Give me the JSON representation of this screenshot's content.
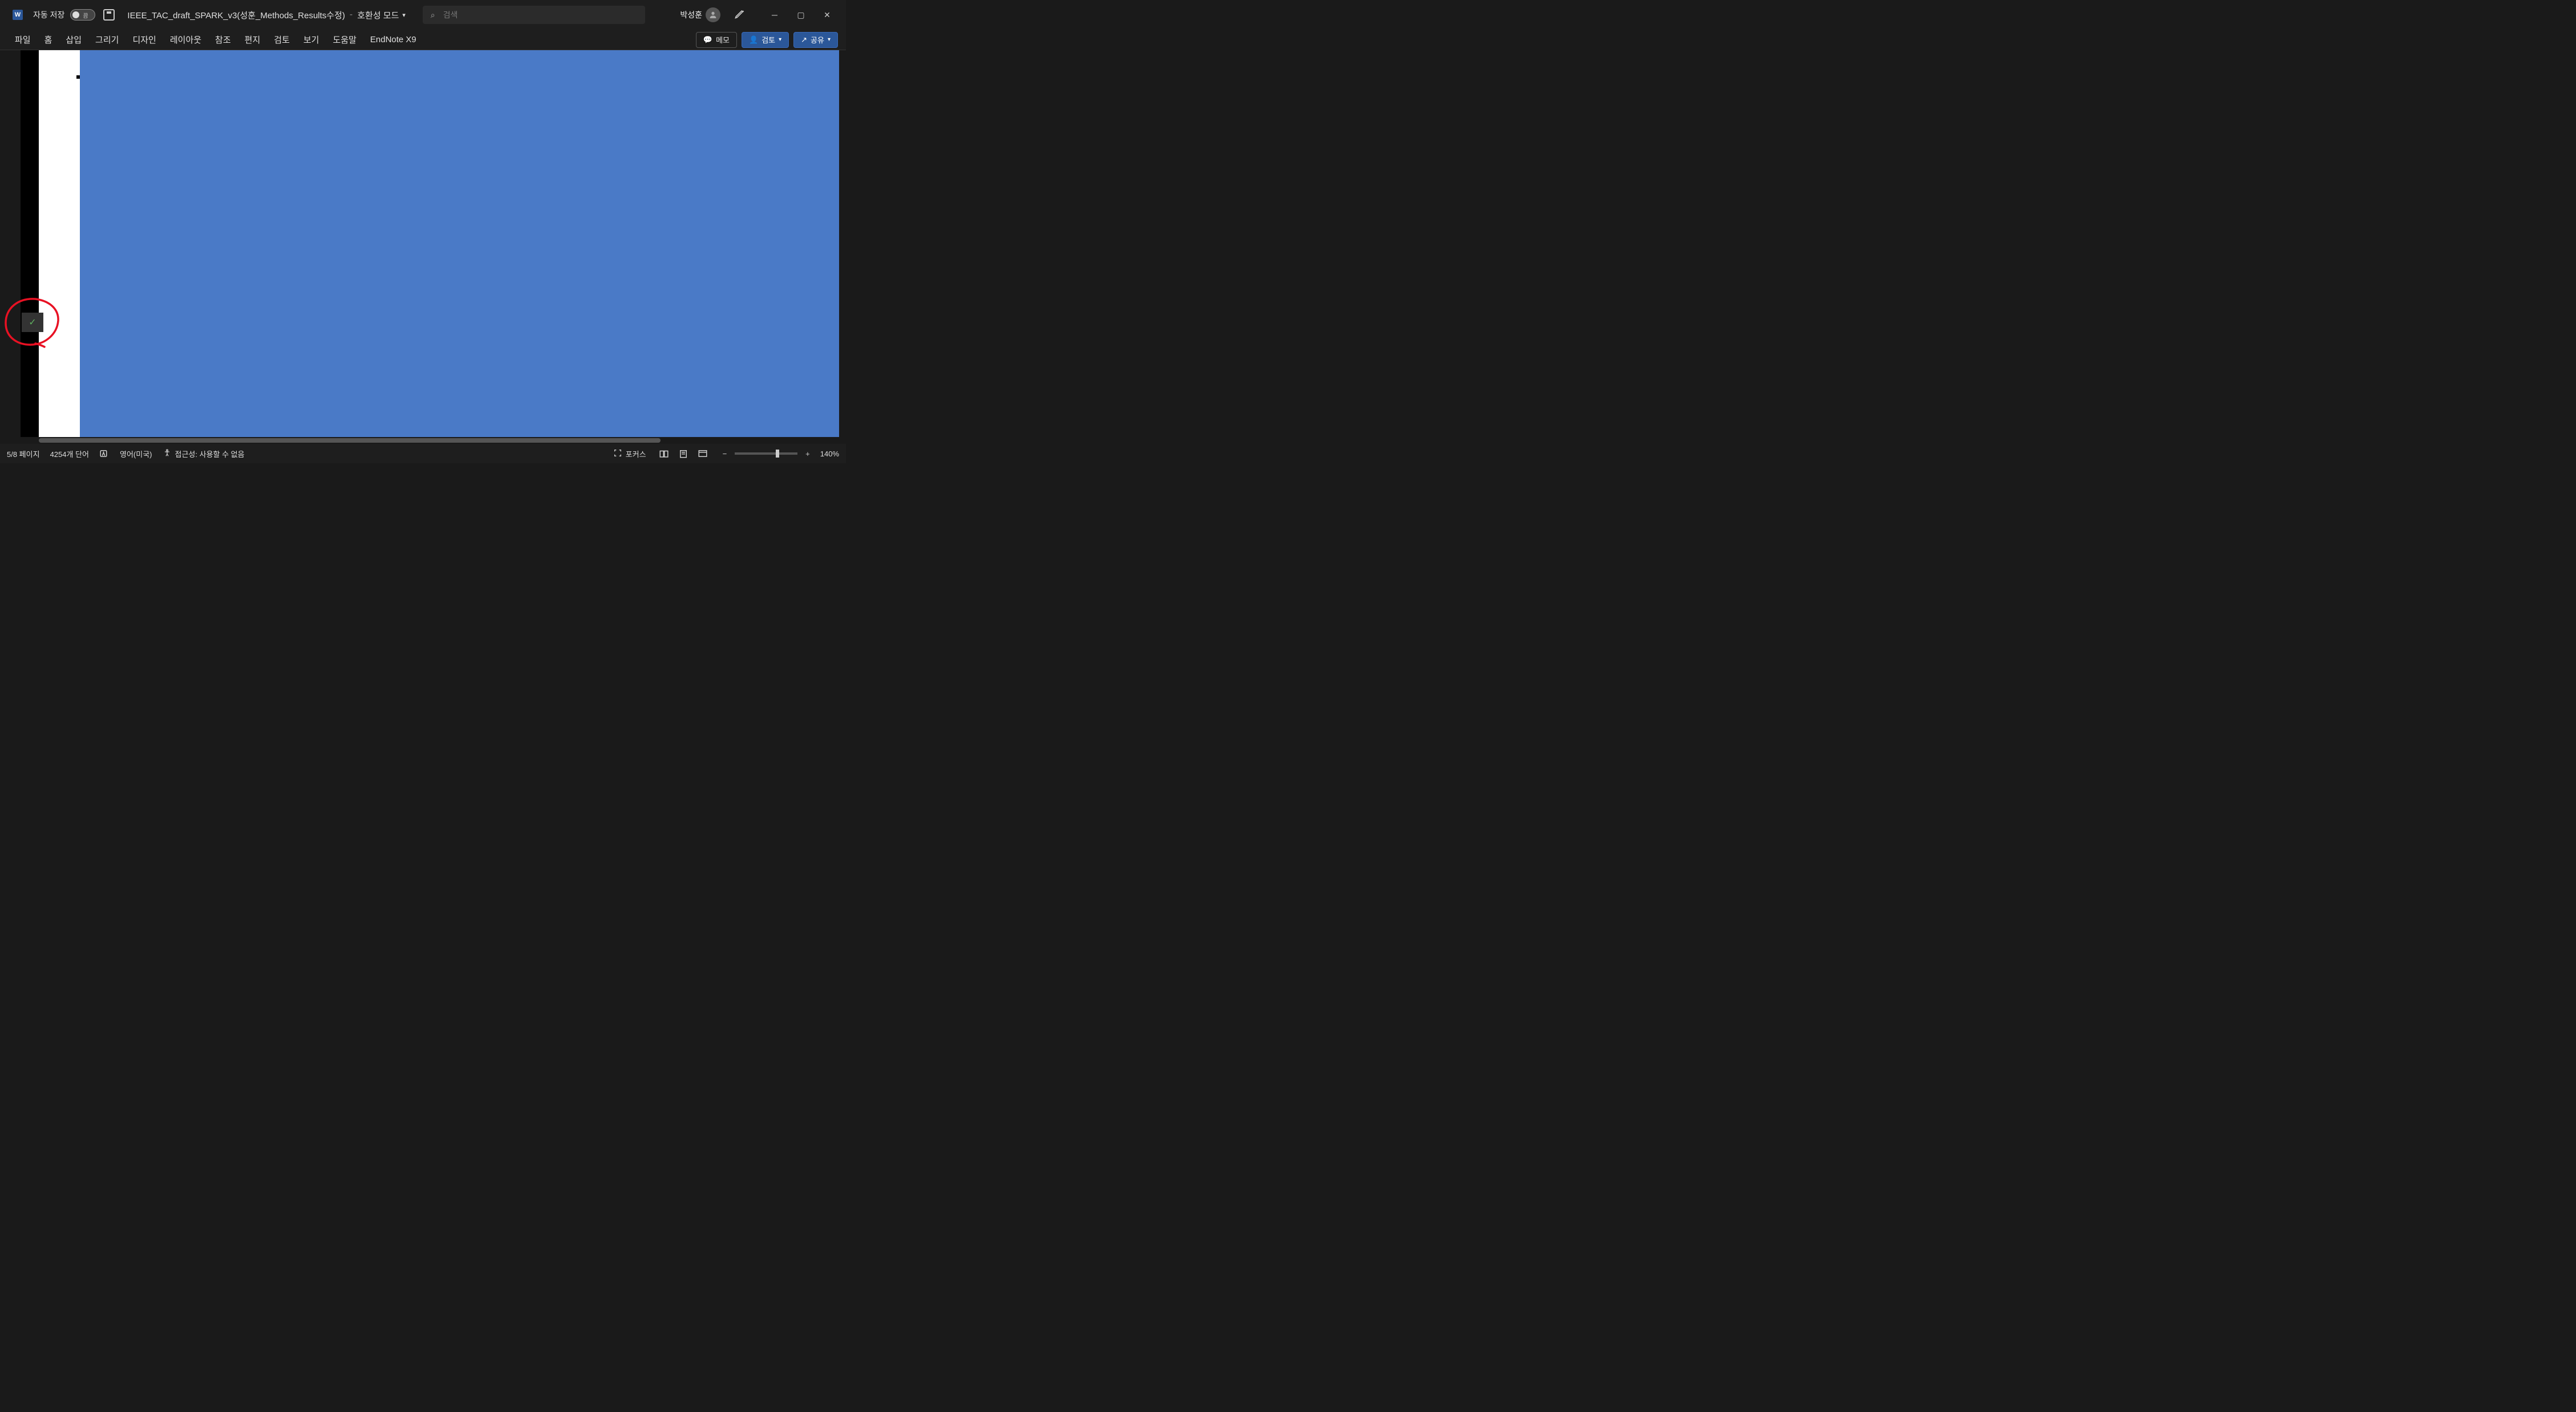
{
  "titlebar": {
    "autosave_label": "자동 저장",
    "autosave_state": "끔",
    "doc_title": "IEEE_TAC_draft_SPARK_v3(성훈_Methods_Results수정)",
    "compat_mode": "호환성 모드",
    "search_placeholder": "검색",
    "user_name": "박성훈"
  },
  "ribbon": {
    "tabs": [
      "파일",
      "홈",
      "삽입",
      "그리기",
      "디자인",
      "레이아웃",
      "참조",
      "편지",
      "검토",
      "보기",
      "도움말"
    ],
    "endnote_tab": "EndNote X9",
    "memo_btn": "메모",
    "review_btn": "검토",
    "share_btn": "공유"
  },
  "statusbar": {
    "page": "5/8 페이지",
    "words": "4254개 단어",
    "language": "영어(미국)",
    "accessibility": "접근성: 사용할 수 없음",
    "focus": "포커스",
    "zoom": "140%"
  }
}
